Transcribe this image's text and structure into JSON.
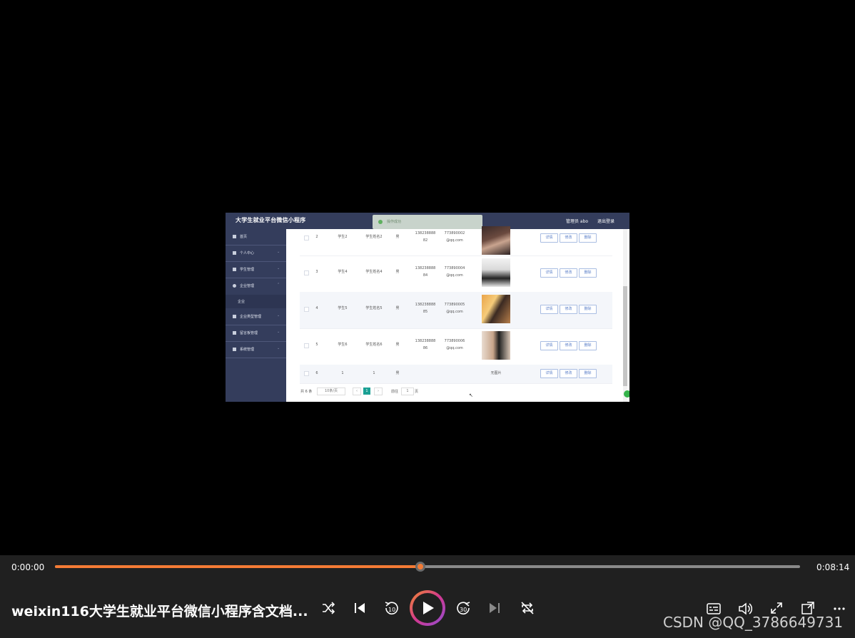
{
  "app": {
    "title": "大学生就业平台微信小程序",
    "admin_label": "管理员 abo",
    "logout_label": "退出登录",
    "toast": "操作成功"
  },
  "sidebar": {
    "items": [
      {
        "label": "首页",
        "icon": "home-icon"
      },
      {
        "label": "个人中心",
        "icon": "user-icon"
      },
      {
        "label": "学生管理",
        "icon": "student-icon"
      },
      {
        "label": "企业管理",
        "icon": "company-icon"
      },
      {
        "label": "企业",
        "icon": ""
      },
      {
        "label": "企业类型管理",
        "icon": "type-icon"
      },
      {
        "label": "留言板管理",
        "icon": "message-icon"
      },
      {
        "label": "系统管理",
        "icon": "system-icon"
      }
    ]
  },
  "table": {
    "rows": [
      {
        "index": "2",
        "account": "学生2",
        "name": "学生姓名2",
        "gender": "男",
        "phone_a": "138238888",
        "phone_b": "82",
        "email_a": "773890002",
        "email_b": "@qq.com",
        "photo": "photo"
      },
      {
        "index": "3",
        "account": "学生4",
        "name": "学生姓名4",
        "gender": "男",
        "phone_a": "138238888",
        "phone_b": "84",
        "email_a": "773890004",
        "email_b": "@qq.com",
        "photo": "photo"
      },
      {
        "index": "4",
        "account": "学生5",
        "name": "学生姓名5",
        "gender": "男",
        "phone_a": "138238888",
        "phone_b": "85",
        "email_a": "773890005",
        "email_b": "@qq.com",
        "photo": "photo"
      },
      {
        "index": "5",
        "account": "学生6",
        "name": "学生姓名6",
        "gender": "男",
        "phone_a": "138238888",
        "phone_b": "86",
        "email_a": "773890006",
        "email_b": "@qq.com",
        "photo": "photo"
      },
      {
        "index": "6",
        "account": "1",
        "name": "1",
        "gender": "男",
        "phone_a": "",
        "phone_b": "",
        "email_a": "",
        "email_b": "",
        "photo": "无图片"
      }
    ],
    "actions": {
      "detail": "详情",
      "edit": "修改",
      "delete": "删除"
    }
  },
  "pager": {
    "total": "共 6 条",
    "page_size": "10条/页",
    "prev": "‹",
    "current": "1",
    "next": "›",
    "goto_label": "前往",
    "goto_value": "1",
    "page_unit": "页"
  },
  "player": {
    "current_time": "0:00:00",
    "total_time": "0:08:14",
    "progress": 0.49,
    "video_title": "weixin116大学生就业平台微信小程序含文档...",
    "accent": "#f47b35"
  },
  "watermark": "CSDN @QQ_3786649731"
}
